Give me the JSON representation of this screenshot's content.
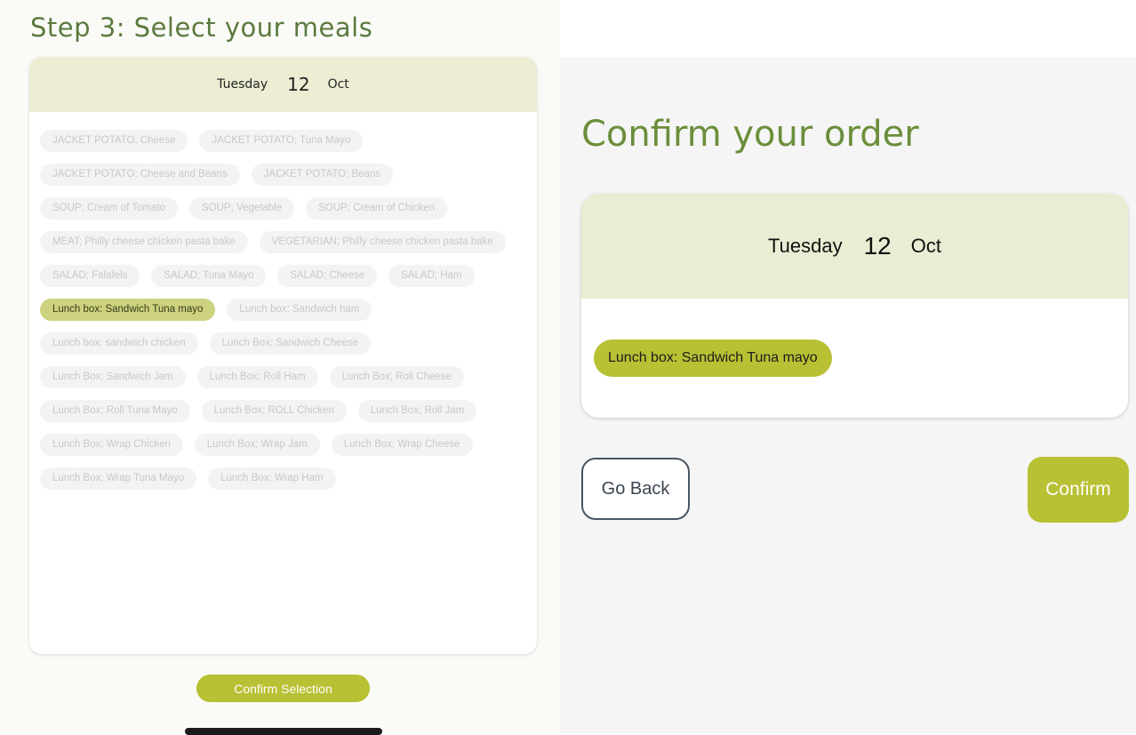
{
  "left": {
    "step_title": "Step 3: Select your meals",
    "date": {
      "day": "Tuesday",
      "number": "12",
      "month": "Oct"
    },
    "meals": [
      {
        "label": "JACKET POTATO; Cheese",
        "selected": false
      },
      {
        "label": "JACKET POTATO; Tuna Mayo",
        "selected": false
      },
      {
        "label": "JACKET POTATO; Cheese and Beans",
        "selected": false
      },
      {
        "label": "JACKET POTATO; Beans",
        "selected": false
      },
      {
        "label": "SOUP; Cream of Tomato",
        "selected": false
      },
      {
        "label": "SOUP; Vegetable",
        "selected": false
      },
      {
        "label": "SOUP; Cream of Chicken",
        "selected": false
      },
      {
        "label": "MEAT; Philly cheese chicken pasta bake",
        "selected": false
      },
      {
        "label": "VEGETARIAN; Philly cheese chicken pasta bake",
        "selected": false
      },
      {
        "label": "SALAD; Falafels",
        "selected": false
      },
      {
        "label": "SALAD; Tuna Mayo",
        "selected": false
      },
      {
        "label": "SALAD; Cheese",
        "selected": false
      },
      {
        "label": "SALAD; Ham",
        "selected": false
      },
      {
        "label": "Lunch box: Sandwich Tuna mayo",
        "selected": true
      },
      {
        "label": "Lunch box: Sandwich ham",
        "selected": false
      },
      {
        "label": "Lunch box: sandwich chicken",
        "selected": false
      },
      {
        "label": "Lunch Box; Sandwich Cheese",
        "selected": false
      },
      {
        "label": "Lunch Box; Sandwich Jam",
        "selected": false
      },
      {
        "label": "Lunch Box; Roll Ham",
        "selected": false
      },
      {
        "label": "Lunch Box; Roll Cheese",
        "selected": false
      },
      {
        "label": "Lunch Box; Roll Tuna Mayo",
        "selected": false
      },
      {
        "label": "Lunch Box; ROLL Chicken",
        "selected": false
      },
      {
        "label": "Lunch Box; Roll Jam",
        "selected": false
      },
      {
        "label": "Lunch Box; Wrap Chicken",
        "selected": false
      },
      {
        "label": "Lunch Box; Wrap Jam",
        "selected": false
      },
      {
        "label": "Lunch Box; Wrap Cheese",
        "selected": false
      },
      {
        "label": "Lunch Box; Wrap Tuna Mayo",
        "selected": false
      },
      {
        "label": "Lunch Box; Wrap Ham",
        "selected": false
      }
    ],
    "confirm_selection_label": "Confirm Selection"
  },
  "right": {
    "title": "Confirm your order",
    "date": {
      "day": "Tuesday",
      "number": "12",
      "month": "Oct"
    },
    "selected_meal": "Lunch box: Sandwich Tuna mayo",
    "go_back_label": "Go Back",
    "confirm_label": "Confirm"
  },
  "colors": {
    "accent": "#b8c033",
    "header_bg": "#ecedd3",
    "title_green": "#6b8e3a"
  }
}
